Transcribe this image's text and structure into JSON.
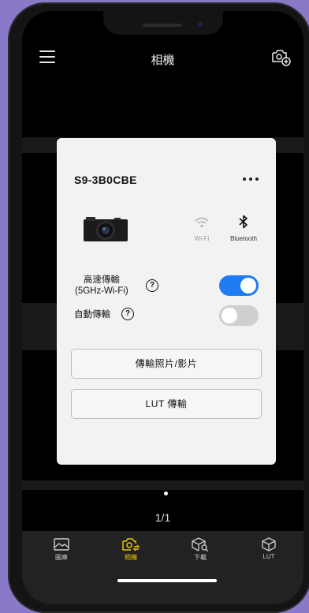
{
  "header": {
    "title": "相機",
    "menu_icon": "hamburger-menu-icon",
    "add_camera_icon": "camera-add-icon"
  },
  "card": {
    "camera_name": "S9-3B0CBE",
    "more_icon": "more-dots-icon",
    "wifi_label": "Wi-Fi",
    "bluetooth_label": "Bluetooth",
    "high_speed_label_line1": "高速傳輸",
    "high_speed_label_line2": "(5GHz-Wi-Fi)",
    "high_speed_on": true,
    "auto_transfer_label": "自動傳輸",
    "auto_transfer_on": false,
    "help_glyph": "?",
    "transfer_button": "傳輸照片/影片",
    "lut_button": "LUT 傳輸"
  },
  "pager": {
    "count": "1/1"
  },
  "tabs": [
    {
      "label": "圖庫",
      "icon": "gallery-icon",
      "active": false
    },
    {
      "label": "相機",
      "icon": "camera-sync-icon",
      "active": true
    },
    {
      "label": "下載",
      "icon": "download-search-icon",
      "active": false
    },
    {
      "label": "LUT",
      "icon": "lut-cube-icon",
      "active": false
    }
  ],
  "colors": {
    "accent": "#f2c500",
    "toggle_on": "#1e7cf2",
    "toggle_off": "#cfcfcf"
  }
}
